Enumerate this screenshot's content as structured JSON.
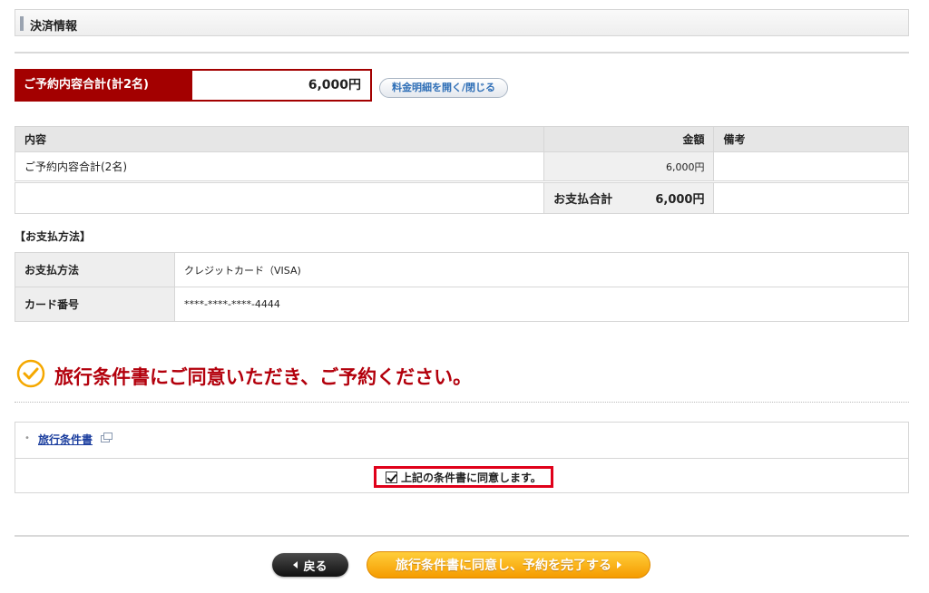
{
  "section": {
    "title": "決済情報"
  },
  "summary": {
    "label": "ご予約内容合計(計2名)",
    "amount": "6,000円",
    "toggle_button": "料金明細を開く/閉じる"
  },
  "breakdown": {
    "headers": [
      "内容",
      "金額",
      "備考"
    ],
    "rows": [
      {
        "item": "ご予約内容合計(2名)",
        "amount": "6,000円",
        "note": ""
      }
    ],
    "payment_total_label": "お支払合計",
    "payment_total_amount": "6,000円"
  },
  "payment_method": {
    "heading": "【お支払方法】",
    "rows": [
      {
        "key": "お支払方法",
        "value": "クレジットカード（VISA)"
      },
      {
        "key": "カード番号",
        "value": "****-****-****-4444"
      }
    ]
  },
  "agreement": {
    "heading": "旅行条件書にご同意いただき、ご予約ください。",
    "terms_link": "旅行条件書",
    "checkbox_label": "上記の条件書に同意します。",
    "checkbox_checked": true
  },
  "actions": {
    "back_label": "戻る",
    "complete_label": "旅行条件書に同意し、予約を完了する"
  },
  "colors": {
    "accent": "#a30000",
    "highlight": "#e0001a",
    "cta": "#f5a800"
  },
  "icons": [
    "check-circle-icon",
    "external-window-icon",
    "arrow-left-icon",
    "arrow-right-icon"
  ]
}
